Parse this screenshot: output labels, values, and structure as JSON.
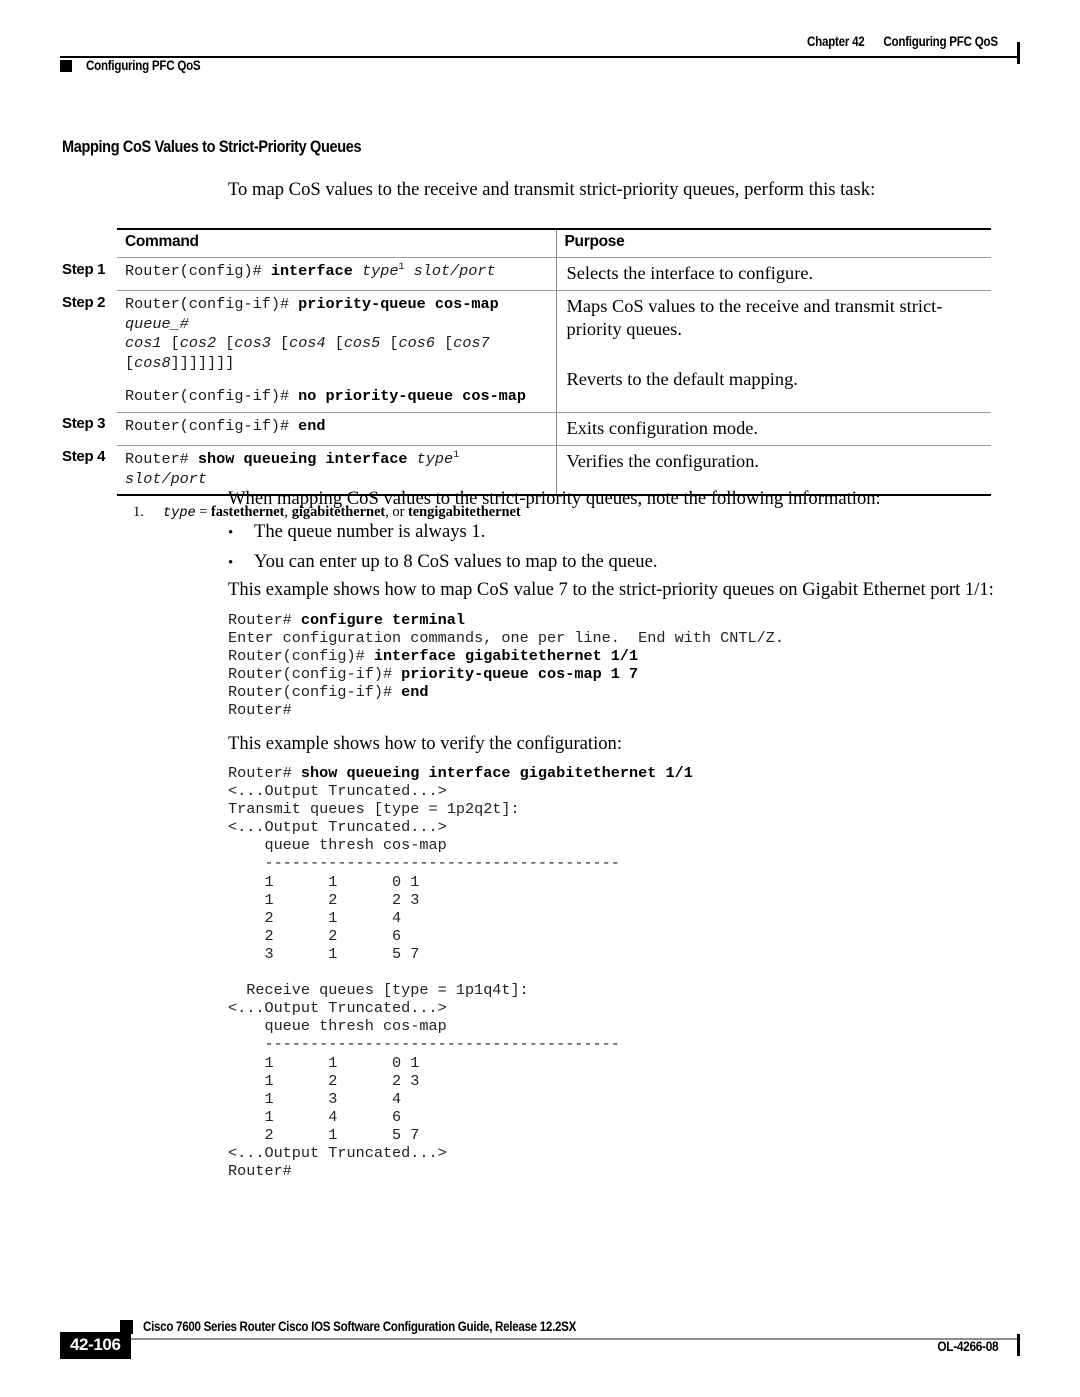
{
  "header": {
    "chapter_number": "Chapter 42",
    "chapter_title": "Configuring PFC QoS",
    "left_title": "Configuring PFC QoS"
  },
  "section": {
    "heading": "Mapping CoS Values to Strict-Priority Queues",
    "intro": "To map CoS values to the receive and transmit strict-priority queues, perform this task:"
  },
  "task_table": {
    "columns": {
      "command": "Command",
      "purpose": "Purpose"
    },
    "steps": [
      {
        "label": "Step 1",
        "command_html": "Router(config)# <b>interface</b> <i>type</i><sup>1</sup> <i>slot/port</i>",
        "purpose": "Selects the interface to configure."
      },
      {
        "label": "Step 2",
        "command_html": "Router(config-if)# <b>priority-queue cos-map</b> <i>queue_#</i>\n<i>cos1</i> [<i>cos2</i> [<i>cos3</i> [<i>cos4</i> [<i>cos5</i> [<i>cos6</i> [<i>cos7</i>\n[<i>cos8</i>]]]]]]]",
        "purpose": "Maps CoS values to the receive and transmit strict-priority queues.",
        "sub_command_html": "Router(config-if)# <b>no priority-queue cos-map</b>",
        "sub_purpose": "Reverts to the default mapping."
      },
      {
        "label": "Step 3",
        "command_html": "Router(config-if)# <b>end</b>",
        "purpose": "Exits configuration mode."
      },
      {
        "label": "Step 4",
        "command_html": "Router# <b>show queueing interface</b> <i>type</i><sup>1</sup> <i>slot/port</i>",
        "purpose": "Verifies the configuration."
      }
    ],
    "footnote_number": "1.",
    "footnote_html": "<span class=\"mono-i\">type</span> = <b>fastethernet</b>, <b>gigabitethernet</b>, or <b>tengigabitethernet</b>"
  },
  "notes": {
    "intro": "When mapping CoS values to the strict-priority queues, note the following information:",
    "bullets": [
      "The queue number is always 1.",
      "You can enter up to 8 CoS values to map to the queue."
    ]
  },
  "example_one": {
    "intro": "This example shows how to map CoS value 7 to the strict-priority queues on Gigabit Ethernet port  1/1:",
    "code_html": "Router# <b>configure terminal</b>\nEnter configuration commands, one per line.  End with CNTL/Z.\nRouter(config)# <b>interface gigabitethernet 1/1</b>\nRouter(config-if)# <b>priority-queue cos-map 1 7</b>\nRouter(config-if)# <b>end</b>\nRouter#"
  },
  "example_two": {
    "intro": "This example shows how to verify the configuration:",
    "code_html": "Router# <b>show queueing interface gigabitethernet 1/1</b>\n&lt;...Output Truncated...&gt;\nTransmit queues [type = 1p2q2t]:\n&lt;...Output Truncated...&gt;\n    queue thresh cos-map\n    ---------------------------------------\n    1      1      0 1\n    1      2      2 3\n    2      1      4\n    2      2      6\n    3      1      5 7\n\n  Receive queues [type = 1p1q4t]:\n&lt;...Output Truncated...&gt;\n    queue thresh cos-map\n    ---------------------------------------\n    1      1      0 1\n    1      2      2 3\n    1      3      4\n    1      4      6\n    2      1      5 7\n&lt;...Output Truncated...&gt;\nRouter#"
  },
  "footer": {
    "guide_title": "Cisco 7600 Series Router Cisco IOS Software Configuration Guide, Release 12.2SX",
    "page_number": "42-106",
    "document_number": "OL-4266-08"
  }
}
